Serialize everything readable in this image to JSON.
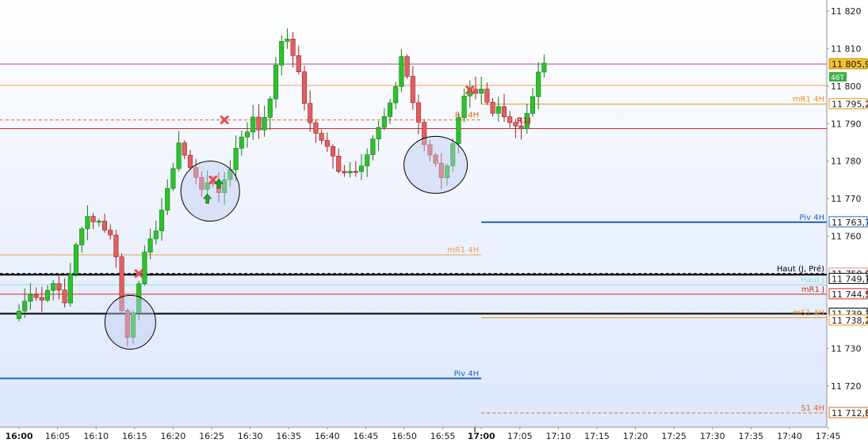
{
  "chart_data": {
    "type": "candlestick",
    "title": "",
    "xlabel": "",
    "ylabel": "",
    "ylim": [
      11709,
      11823
    ],
    "grid": false,
    "x_ticks": [
      {
        "label": "16:00",
        "bold": true
      },
      {
        "label": "16:05"
      },
      {
        "label": "16:10"
      },
      {
        "label": "16:15"
      },
      {
        "label": "16:20"
      },
      {
        "label": "16:25"
      },
      {
        "label": "16:30"
      },
      {
        "label": "16:35"
      },
      {
        "label": "16:40"
      },
      {
        "label": "16:45"
      },
      {
        "label": "16:50"
      },
      {
        "label": "16:55"
      },
      {
        "label": "17:00",
        "bold": true
      },
      {
        "label": "17:05"
      },
      {
        "label": "17:10"
      },
      {
        "label": "17:15"
      },
      {
        "label": "17:20"
      },
      {
        "label": "17:25"
      },
      {
        "label": "17:30"
      },
      {
        "label": "17:35"
      },
      {
        "label": "17:40"
      },
      {
        "label": "17:45"
      }
    ],
    "y_ticks": [
      "11 820",
      "11 810",
      "11 800",
      "11 790",
      "11 780",
      "11 770",
      "11 760",
      "11 730",
      "11 720"
    ],
    "y_tick_values": [
      11820,
      11810,
      11800,
      11790,
      11780,
      11770,
      11760,
      11730,
      11720
    ],
    "price_path": [
      [
        0,
        11740
      ],
      [
        2,
        11745
      ],
      [
        4,
        11743
      ],
      [
        6,
        11748
      ],
      [
        8,
        11742
      ],
      [
        10,
        11758
      ],
      [
        12,
        11765
      ],
      [
        14,
        11764
      ],
      [
        16,
        11760
      ],
      [
        17,
        11755
      ],
      [
        18,
        11740
      ],
      [
        19,
        11733
      ],
      [
        20,
        11740
      ],
      [
        21,
        11748
      ],
      [
        22,
        11755
      ],
      [
        24,
        11762
      ],
      [
        26,
        11772
      ],
      [
        28,
        11785
      ],
      [
        30,
        11778
      ],
      [
        31,
        11776
      ],
      [
        32,
        11773
      ],
      [
        34,
        11774
      ],
      [
        35,
        11772
      ],
      [
        37,
        11778
      ],
      [
        38,
        11784
      ],
      [
        40,
        11788
      ],
      [
        41,
        11792
      ],
      [
        42,
        11789
      ],
      [
        43,
        11791
      ],
      [
        44,
        11797
      ],
      [
        45,
        11805
      ],
      [
        46,
        11812
      ],
      [
        47,
        11813
      ],
      [
        48,
        11808
      ],
      [
        49,
        11804
      ],
      [
        50,
        11795
      ],
      [
        51,
        11790
      ],
      [
        52,
        11788
      ],
      [
        53,
        11786
      ],
      [
        54,
        11784
      ],
      [
        55,
        11782
      ],
      [
        56,
        11778
      ],
      [
        57,
        11777
      ],
      [
        58,
        11777
      ],
      [
        59,
        11777
      ],
      [
        60,
        11778
      ],
      [
        61,
        11782
      ],
      [
        62,
        11786
      ],
      [
        63,
        11789
      ],
      [
        64,
        11792
      ],
      [
        65,
        11795
      ],
      [
        66,
        11800
      ],
      [
        67,
        11808
      ],
      [
        68,
        11803
      ],
      [
        69,
        11796
      ],
      [
        70,
        11790
      ],
      [
        71,
        11785
      ],
      [
        72,
        11782
      ],
      [
        73,
        11779
      ],
      [
        74,
        11775
      ],
      [
        75,
        11778
      ],
      [
        76,
        11784
      ],
      [
        77,
        11791
      ],
      [
        78,
        11797
      ],
      [
        79,
        11799
      ],
      [
        80,
        11798
      ],
      [
        81,
        11800
      ],
      [
        82,
        11796
      ],
      [
        83,
        11793
      ],
      [
        84,
        11795
      ],
      [
        85,
        11792
      ],
      [
        86,
        11790
      ],
      [
        87,
        11789
      ],
      [
        88,
        11789
      ],
      [
        89,
        11792
      ],
      [
        90,
        11798
      ],
      [
        91,
        11804
      ],
      [
        92,
        11806
      ]
    ],
    "bars_per_5min": 6.75,
    "reference_lines": [
      {
        "value": 11805.9,
        "color": "#b040b0",
        "style": "solid",
        "from": "left",
        "width": 1
      },
      {
        "value": 11800.2,
        "color": "#f0a050",
        "style": "solid",
        "from": "left",
        "width": 1
      },
      {
        "value": 11795.2,
        "label": "mR1 4H",
        "color": "#e8951f",
        "style": "solid",
        "from": "17:00",
        "width": 1
      },
      {
        "value": 11791.0,
        "label": "R1 4H",
        "color": "#e06820",
        "style": "dashed",
        "from": "left",
        "to": "17:00",
        "width": 1
      },
      {
        "value": 11788.7,
        "color": "#d02828",
        "style": "solid",
        "from": "left",
        "width": 1
      },
      {
        "value": 11763.7,
        "label": "Piv 4H",
        "color": "#1f66b8",
        "style": "solid",
        "from": "17:00",
        "width": 2
      },
      {
        "value": 11755.0,
        "label": "mR1 4H",
        "color": "#f0a050",
        "style": "solid",
        "from": "left",
        "to": "17:00",
        "width": 1
      },
      {
        "value": 11750.0,
        "label": "Haut (J, Pré)",
        "color": "#000000",
        "style": "dashed",
        "from": "left",
        "width": 1
      },
      {
        "value": 11749.7,
        "color": "#000000",
        "style": "solid",
        "from": "left",
        "width": 2
      },
      {
        "value": 11747.0,
        "label": "Haut J",
        "color": "#8fe0d8",
        "style": "solid",
        "from": "left",
        "width": 1
      },
      {
        "value": 11744.5,
        "label": "mR1 J",
        "color": "#d02828",
        "style": "solid",
        "from": "left",
        "width": 1
      },
      {
        "value": 11739.3,
        "color": "#000000",
        "style": "solid",
        "from": "left",
        "width": 2
      },
      {
        "value": 11738.2,
        "label": "mS1 4H",
        "color": "#e8951f",
        "style": "solid",
        "from": "17:00",
        "width": 1
      },
      {
        "value": 11722.0,
        "label": "Piv 4H",
        "color": "#1f66b8",
        "style": "solid",
        "from": "left",
        "to": "17:00",
        "width": 2
      },
      {
        "value": 11712.8,
        "label": "S1 4H",
        "color": "#e06820",
        "style": "dashed",
        "from": "17:00",
        "width": 1
      }
    ],
    "price_tags": [
      {
        "text": "11 805,9",
        "value": 11805.9,
        "bg": "#f2c230",
        "fg": "#000000",
        "border": "#c09000"
      },
      {
        "text": "11 795,2",
        "value": 11795.2,
        "bg": "#ffffff",
        "fg": "#e8951f",
        "border": "#e8951f"
      },
      {
        "text": "11 763,7",
        "value": 11763.7,
        "bg": "#ffffff",
        "fg": "#1f66b8",
        "border": "#1f66b8"
      },
      {
        "text": "11 750,0",
        "value": 11750.0,
        "bg": "#ffffff",
        "fg": "#e08a8a",
        "border": "#e08a8a"
      },
      {
        "text": "11 749,7",
        "value": 11748.6,
        "bg": "#ffffff",
        "fg": "#000000",
        "border": "#000000"
      },
      {
        "text": "11 744,5",
        "value": 11744.5,
        "bg": "#ffffff",
        "fg": "#d02828",
        "border": "#d02828"
      },
      {
        "text": "11 739,3",
        "value": 11739.3,
        "bg": "#ffffff",
        "fg": "#000000",
        "border": "#000000"
      },
      {
        "text": "11 738,2",
        "value": 11737.5,
        "bg": "#ffffff",
        "fg": "#e8951f",
        "border": "#e8951f"
      },
      {
        "text": "11 712,8",
        "value": 11712.8,
        "bg": "#ffffff",
        "fg": "#e06820",
        "border": "#e06820"
      }
    ],
    "countdown_badge": {
      "text": "46T",
      "value": 11802.5,
      "bg": "#3cb043",
      "fg": "#ffffff"
    },
    "annotations": [
      {
        "text": "R1J",
        "value": 11791,
        "time_bar": 88,
        "color": "#d02828"
      }
    ],
    "markers": [
      {
        "shape": "x",
        "value": 11791,
        "time_bar": 36,
        "color": "#e05050"
      },
      {
        "shape": "x",
        "value": 11750,
        "time_bar": 21,
        "color": "#e05050"
      },
      {
        "shape": "x",
        "value": 11775,
        "time_bar": 34,
        "color": "#e05050"
      },
      {
        "shape": "x",
        "value": 11799,
        "time_bar": 79,
        "color": "#e05050"
      },
      {
        "shape": "arrow-up",
        "value": 11770,
        "time_bar": 33,
        "color": "#28a028"
      },
      {
        "shape": "arrow-up",
        "value": 11774,
        "time_bar": 35,
        "color": "#28a028"
      }
    ],
    "circles": [
      {
        "time_bar": 19.5,
        "value": 11737,
        "rx": 32,
        "ry": 34
      },
      {
        "time_bar": 33.5,
        "value": 11772,
        "rx": 37,
        "ry": 38
      },
      {
        "time_bar": 73,
        "value": 11779,
        "rx": 40,
        "ry": 36
      }
    ],
    "colors": {
      "up": "#2cc22c",
      "up_edge": "#177a17",
      "down": "#e06060",
      "down_edge": "#a02020",
      "wick": "#555555",
      "bg_top": "#ffffff",
      "bg_bottom": "#dde7fb"
    }
  }
}
